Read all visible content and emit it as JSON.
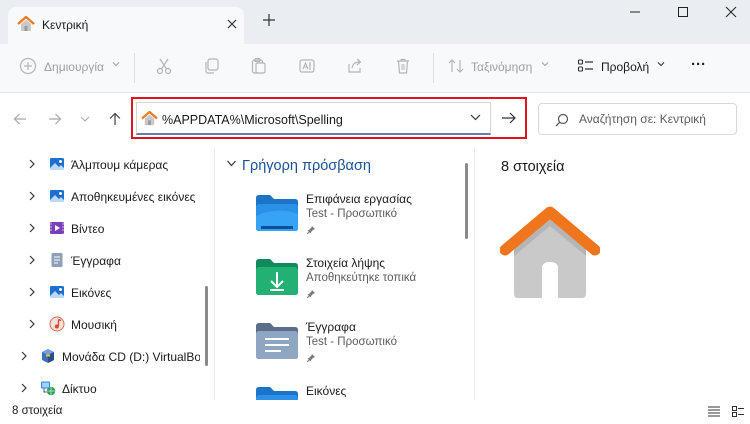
{
  "tab": {
    "title": "Κεντρική"
  },
  "toolbar": {
    "new_label": "Δημιουργία",
    "sort_label": "Ταξινόμηση",
    "view_label": "Προβολή",
    "more_label": "···"
  },
  "address": {
    "path": "%APPDATA%\\Microsoft\\Spelling",
    "search_placeholder": "Αναζήτηση σε: Κεντρική"
  },
  "sidebar": {
    "items": [
      {
        "label": "Άλμπουμ κάμερας",
        "icon": "camera-roll-icon"
      },
      {
        "label": "Αποθηκευμένες εικόνες",
        "icon": "saved-pictures-icon"
      },
      {
        "label": "Βίντεο",
        "icon": "videos-icon"
      },
      {
        "label": "Έγγραφα",
        "icon": "documents-icon"
      },
      {
        "label": "Εικόνες",
        "icon": "pictures-icon"
      },
      {
        "label": "Μουσική",
        "icon": "music-icon"
      },
      {
        "label": "Μονάδα CD (D:) VirtualBo",
        "icon": "cd-drive-icon"
      },
      {
        "label": "Δίκτυο",
        "icon": "network-icon"
      }
    ]
  },
  "main": {
    "section_title": "Γρήγορη πρόσβαση",
    "items": [
      {
        "name": "Επιφάνεια εργασίας",
        "sub": "Test - Προσωπικό",
        "icon": "desktop-folder-icon"
      },
      {
        "name": "Στοιχεία λήψης",
        "sub": "Αποθηκεύτηκε τοπικά",
        "icon": "downloads-folder-icon"
      },
      {
        "name": "Έγγραφα",
        "sub": "Test - Προσωπικό",
        "icon": "documents-folder-icon"
      },
      {
        "name": "Εικόνες",
        "sub": "",
        "icon": "pictures-folder-icon"
      }
    ]
  },
  "details": {
    "count": "8 στοιχεία"
  },
  "status": {
    "count": "8 στοιχεία"
  },
  "colors": {
    "accent": "#1a4f96",
    "highlight_border": "#e0141e",
    "house_roof": "#f0761e"
  }
}
